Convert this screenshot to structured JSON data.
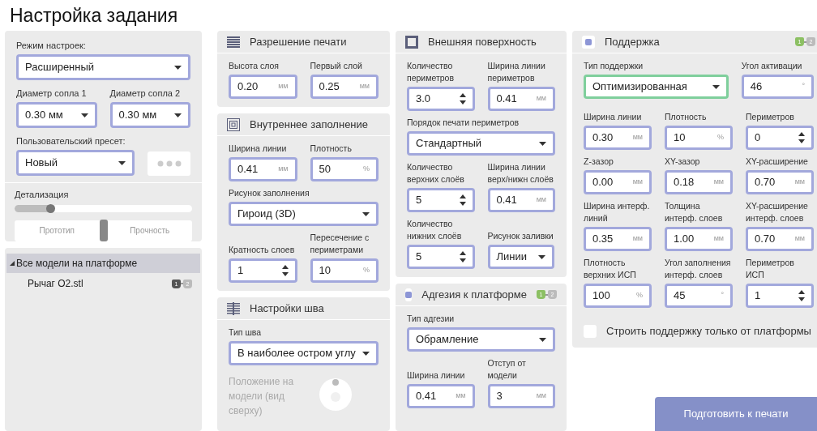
{
  "title": "Настройка задания",
  "settings_panel": {
    "mode": {
      "label": "Режим настроек:",
      "value": "Расширенный"
    },
    "nozzles": [
      {
        "label": "Диаметр сопла 1",
        "value": "0.30 мм"
      },
      {
        "label": "Диаметр сопла 2",
        "value": "0.30 мм"
      }
    ],
    "preset": {
      "label": "Пользовательский пресет:",
      "value": "Новый"
    },
    "detail": {
      "label": "Детализация",
      "level": 0.22
    },
    "toggle": {
      "left": "Прототип",
      "right": "Прочность"
    }
  },
  "models_panel": {
    "root": {
      "label": "Все модели на платформе",
      "expanded": true,
      "children": [
        {
          "name": "Рычаг О2.stl",
          "extruders": [
            {
              "label": "1",
              "color": "#555555"
            },
            {
              "label": "2",
              "color": "#bbbbbb"
            }
          ]
        }
      ]
    }
  },
  "columns": [
    [
      {
        "kind": "resolution",
        "title": "Разрешение печати",
        "rows": [
          [
            {
              "kind": "number",
              "label": "Высота слоя",
              "value": "0.20",
              "unit": "мм"
            },
            {
              "kind": "number",
              "label": "Первый слой",
              "value": "0.25",
              "unit": "мм"
            }
          ]
        ]
      },
      {
        "kind": "infill",
        "title": "Внутреннее заполнение",
        "rows": [
          [
            {
              "kind": "number",
              "label": "Ширина линии",
              "value": "0.41",
              "unit": "мм"
            },
            {
              "kind": "number",
              "label": "Плотность",
              "value": "50",
              "unit": "%"
            }
          ],
          [
            {
              "kind": "select",
              "label": "Рисунок заполнения",
              "value": "Гироид (3D)"
            }
          ],
          [
            {
              "kind": "spinner",
              "label": "Кратность слоев",
              "value": "1"
            },
            {
              "kind": "number",
              "label": "Пересечение с периметрами",
              "value": "10",
              "unit": "%"
            }
          ]
        ]
      },
      {
        "kind": "seam",
        "title": "Настройки шва",
        "rows": [
          [
            {
              "kind": "select",
              "label": "Тип шва",
              "value": "В наиболее остром углу"
            }
          ],
          [
            {
              "kind": "position",
              "label": "Положение на модели (вид сверху)",
              "disabled": true
            }
          ]
        ]
      }
    ],
    [
      {
        "kind": "surface",
        "title": "Внешняя поверхность",
        "rows": [
          [
            {
              "kind": "spinner",
              "label": "Количество периметров",
              "value": "3.0"
            },
            {
              "kind": "number",
              "label": "Ширина линии периметров",
              "value": "0.41",
              "unit": "мм"
            }
          ],
          [
            {
              "kind": "select",
              "label": "Порядок печати периметров",
              "value": "Стандартный"
            }
          ],
          [
            {
              "kind": "spinner",
              "label": "Количество верхних слоёв",
              "value": "5"
            },
            {
              "kind": "number",
              "label": "Ширина линии верх/нижн слоёв",
              "value": "0.41",
              "unit": "мм"
            }
          ],
          [
            {
              "kind": "spinner",
              "label": "Количество нижних слоёв",
              "value": "5"
            },
            {
              "kind": "select",
              "label": "Рисунок заливки",
              "value": "Линии",
              "narrow": true
            }
          ]
        ]
      },
      {
        "kind": "toggle",
        "title": "Адгезия к платформе",
        "checked": true,
        "extruders": [
          {
            "label": "1",
            "color": "#8cc063"
          },
          {
            "label": "2",
            "color": "#bbbbbb"
          }
        ],
        "rows": [
          [
            {
              "kind": "select",
              "label": "Тип адгезии",
              "value": "Обрамление"
            }
          ],
          [
            {
              "kind": "number",
              "label": "Ширина линии",
              "value": "0.41",
              "unit": "мм"
            },
            {
              "kind": "number",
              "label": "Отступ от модели",
              "value": "3",
              "unit": "мм"
            }
          ]
        ]
      }
    ],
    [
      {
        "kind": "toggle",
        "title": "Поддержка",
        "checked": true,
        "extruders": [
          {
            "label": "1",
            "color": "#8cc063"
          },
          {
            "label": "2",
            "color": "#bbbbbb"
          }
        ],
        "top_fields": [
          {
            "kind": "select",
            "label": "Тип поддержки",
            "value": "Оптимизированная",
            "wide": true,
            "focused": true
          },
          {
            "kind": "number",
            "label": "Угол активации",
            "value": "46",
            "unit": "°"
          }
        ],
        "rows": [
          [
            {
              "kind": "number",
              "label": "Ширина линии",
              "value": "0.30",
              "unit": "мм"
            },
            {
              "kind": "number",
              "label": "Плотность",
              "value": "10",
              "unit": "%"
            },
            {
              "kind": "spinner",
              "label": "Периметров",
              "value": "0"
            }
          ],
          [
            {
              "kind": "number",
              "label": "Z-зазор",
              "value": "0.00",
              "unit": "мм"
            },
            {
              "kind": "number",
              "label": "XY-зазор",
              "value": "0.18",
              "unit": "мм"
            },
            {
              "kind": "number",
              "label": "XY-расширение",
              "value": "0.70",
              "unit": "мм"
            }
          ],
          [
            {
              "kind": "number",
              "label": "Ширина интерф. линий",
              "value": "0.35",
              "unit": "мм"
            },
            {
              "kind": "number",
              "label": "Толщина интерф. слоев",
              "value": "1.00",
              "unit": "мм"
            },
            {
              "kind": "number",
              "label": "XY-расширение интерф. слоев",
              "value": "0.70",
              "unit": "мм"
            }
          ],
          [
            {
              "kind": "number",
              "label": "Плотность верхних ИСП",
              "value": "100",
              "unit": "%"
            },
            {
              "kind": "number",
              "label": "Угол заполнения интерф. слоев",
              "value": "45",
              "unit": "°"
            },
            {
              "kind": "spinner",
              "label": "Периметров ИСП",
              "value": "1"
            }
          ],
          [
            {
              "kind": "checkbox",
              "label": "Строить поддержку только от платформы",
              "checked": false
            }
          ]
        ]
      }
    ]
  ],
  "prepare_button": "Подготовить к печати"
}
